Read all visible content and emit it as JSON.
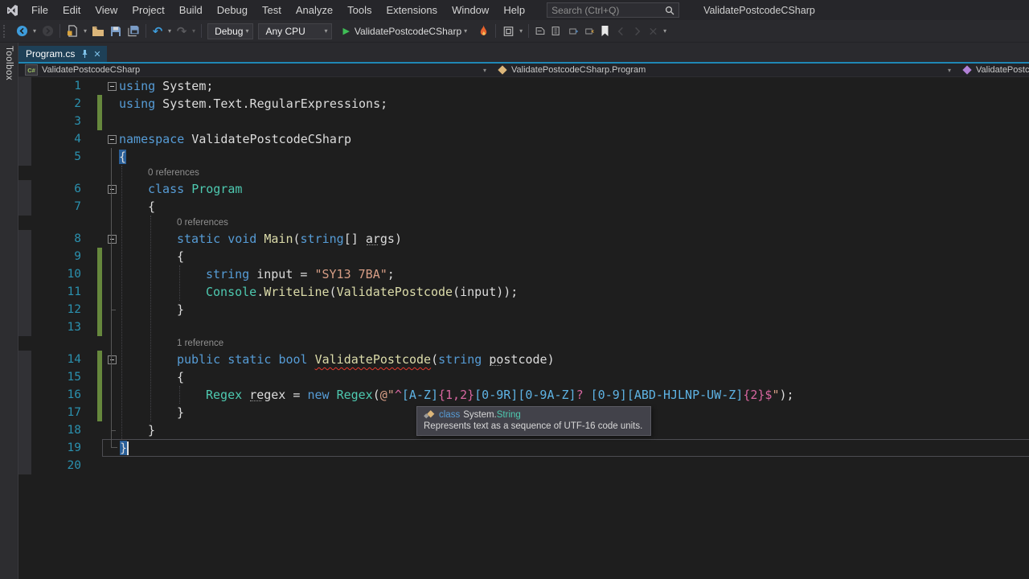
{
  "titlebar": {
    "menus": [
      "File",
      "Edit",
      "View",
      "Project",
      "Build",
      "Debug",
      "Test",
      "Analyze",
      "Tools",
      "Extensions",
      "Window",
      "Help"
    ],
    "search_placeholder": "Search (Ctrl+Q)",
    "solution_name": "ValidatePostcodeCSharp"
  },
  "toolbar": {
    "debug_config": "Debug",
    "platform": "Any CPU",
    "run_target": "ValidatePostcodeCSharp"
  },
  "toolbox_label": "Toolbox",
  "tab": {
    "title": "Program.cs"
  },
  "breadcrumbs": [
    {
      "label": "ValidatePostcodeCSharp",
      "icon": "csharp-project"
    },
    {
      "label": "ValidatePostcodeCSharp.Program",
      "icon": "class"
    },
    {
      "label": "ValidatePostcode(s",
      "icon": "method"
    }
  ],
  "tooltip": {
    "kind": "class",
    "ns": "System.",
    "type": "String",
    "description": "Represents text as a sequence of UTF-16 code units."
  },
  "icons": {
    "close": "✕",
    "caret": "▾",
    "play": "▶",
    "undo": "↶",
    "redo": "↷",
    "csharp": "C#"
  },
  "colors": {
    "accent_line": "#1f87b5",
    "editor_background": "#1e1e1e",
    "keyword": "#569cd6",
    "type_name": "#4ec9b0",
    "method_name": "#dcdcaa",
    "string_literal": "#d69d85",
    "regex_char_class": "#5eb3e4",
    "regex_anchor_quantifier": "#d766a0",
    "line_number": "#2b91af",
    "change_bar_green": "#66883d",
    "error_squiggle": "#e5392e",
    "run_button_green": "#3fbe56",
    "active_tab_background": "#1e4057"
  },
  "editor": {
    "lines": [
      {
        "num": "1",
        "fold": true,
        "indent": 0,
        "segs": [
          [
            "kw",
            "using"
          ],
          [
            "pl",
            " System;"
          ]
        ]
      },
      {
        "num": "2",
        "bar": true,
        "indent": 0,
        "segs": [
          [
            "kw",
            "using"
          ],
          [
            "pl",
            " System.Text.RegularExpressions;"
          ]
        ]
      },
      {
        "num": "3",
        "bar": true,
        "indent": 0,
        "segs": []
      },
      {
        "num": "4",
        "fold": true,
        "indent": 0,
        "segs": [
          [
            "kw",
            "namespace"
          ],
          [
            "pl",
            " ValidatePostcodeCSharp"
          ]
        ]
      },
      {
        "num": "5",
        "indent": 0,
        "segs": [
          [
            "pl",
            "{",
            "hl"
          ]
        ]
      },
      {
        "num": "6",
        "fold": true,
        "indent": 1,
        "lens": "0 references",
        "segs": [
          [
            "kw",
            "class"
          ],
          [
            "pl",
            " "
          ],
          [
            "ty",
            "Program"
          ]
        ]
      },
      {
        "num": "7",
        "indent": 1,
        "segs": [
          [
            "pl",
            "{"
          ]
        ]
      },
      {
        "num": "8",
        "fold": true,
        "indent": 2,
        "lens": "0 references",
        "segs": [
          [
            "kw",
            "static"
          ],
          [
            "pl",
            " "
          ],
          [
            "kw",
            "void"
          ],
          [
            "pl",
            " "
          ],
          [
            "me",
            "Main"
          ],
          [
            "pl",
            "("
          ],
          [
            "kw",
            "string"
          ],
          [
            "pl",
            "[] "
          ],
          [
            "pl",
            "args",
            "dot"
          ],
          [
            "pl",
            ")"
          ]
        ]
      },
      {
        "num": "9",
        "bar": true,
        "indent": 2,
        "segs": [
          [
            "pl",
            "{"
          ]
        ]
      },
      {
        "num": "10",
        "bar": true,
        "indent": 3,
        "segs": [
          [
            "kw",
            "string"
          ],
          [
            "pl",
            " input = "
          ],
          [
            "st",
            "\"SY13 7BA\""
          ],
          [
            "pl",
            ";"
          ]
        ]
      },
      {
        "num": "11",
        "bar": true,
        "indent": 3,
        "segs": [
          [
            "ty",
            "Console"
          ],
          [
            "pl",
            "."
          ],
          [
            "me",
            "WriteLine"
          ],
          [
            "pl",
            "("
          ],
          [
            "me",
            "ValidatePostcode"
          ],
          [
            "pl",
            "("
          ],
          [
            "pl",
            "input"
          ],
          [
            "pl",
            "));"
          ]
        ]
      },
      {
        "num": "12",
        "bar": true,
        "indent": 2,
        "segs": [
          [
            "pl",
            "}"
          ]
        ]
      },
      {
        "num": "13",
        "bar": true,
        "indent": 0,
        "segs": []
      },
      {
        "num": "14",
        "bar": true,
        "fold": true,
        "indent": 2,
        "lens": "1 reference",
        "segs": [
          [
            "kw",
            "public"
          ],
          [
            "pl",
            " "
          ],
          [
            "kw",
            "static"
          ],
          [
            "pl",
            " "
          ],
          [
            "kw",
            "bool"
          ],
          [
            "pl",
            " "
          ],
          [
            "me",
            "ValidatePostcode",
            "sq"
          ],
          [
            "pl",
            "("
          ],
          [
            "kw",
            "string"
          ],
          [
            "pl",
            " "
          ],
          [
            "pl",
            "postcode",
            "dot"
          ],
          [
            "pl",
            ")"
          ]
        ]
      },
      {
        "num": "15",
        "bar": true,
        "indent": 2,
        "segs": [
          [
            "pl",
            "{"
          ]
        ]
      },
      {
        "num": "16",
        "bar": true,
        "indent": 3,
        "segs": [
          [
            "ty",
            "Regex"
          ],
          [
            "pl",
            " "
          ],
          [
            "pl",
            "regex",
            "dot"
          ],
          [
            "pl",
            " = "
          ],
          [
            "kw",
            "new"
          ],
          [
            "pl",
            " "
          ],
          [
            "ty",
            "Regex"
          ],
          [
            "pl",
            "("
          ],
          [
            "st",
            "@\""
          ],
          [
            "rq",
            "^"
          ],
          [
            "rc",
            "[A-Z]"
          ],
          [
            "rq",
            "{1,2}"
          ],
          [
            "rc",
            "[0-9R]"
          ],
          [
            "rc",
            "[0-9A-Z]"
          ],
          [
            "rq",
            "?"
          ],
          [
            "st",
            " "
          ],
          [
            "rc",
            "[0-9]"
          ],
          [
            "rc",
            "[ABD-HJLNP-UW-Z]"
          ],
          [
            "rq",
            "{2}"
          ],
          [
            "rq",
            "$"
          ],
          [
            "st",
            "\""
          ],
          [
            "pl",
            ");"
          ]
        ]
      },
      {
        "num": "17",
        "bar": true,
        "indent": 2,
        "segs": [
          [
            "pl",
            "}"
          ]
        ]
      },
      {
        "num": "18",
        "indent": 1,
        "segs": [
          [
            "pl",
            "}"
          ]
        ]
      },
      {
        "num": "19",
        "current": true,
        "indent": 0,
        "segs": [
          [
            "pl",
            "}",
            "hl",
            "cur"
          ]
        ]
      },
      {
        "num": "20",
        "indent": 0,
        "segs": []
      }
    ]
  }
}
